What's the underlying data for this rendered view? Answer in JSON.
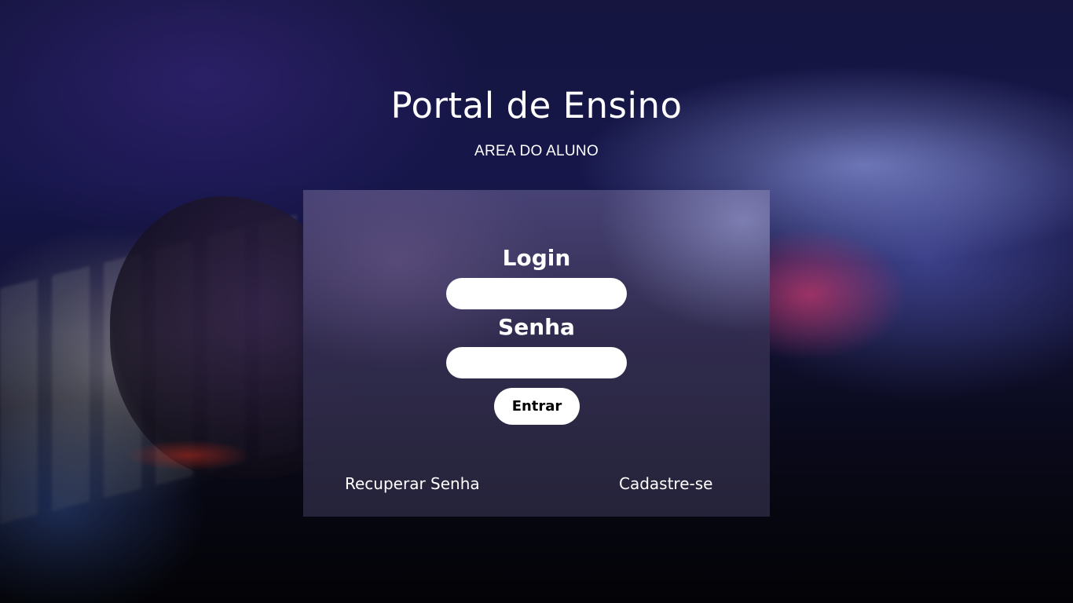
{
  "header": {
    "title": "Portal de Ensino",
    "subtitle": "AREA DO ALUNO"
  },
  "login_form": {
    "login_label": "Login",
    "login_value": "",
    "senha_label": "Senha",
    "senha_value": "",
    "submit_label": "Entrar"
  },
  "footer_links": {
    "recover_label": "Recuperar Senha",
    "signup_label": "Cadastre-se"
  }
}
